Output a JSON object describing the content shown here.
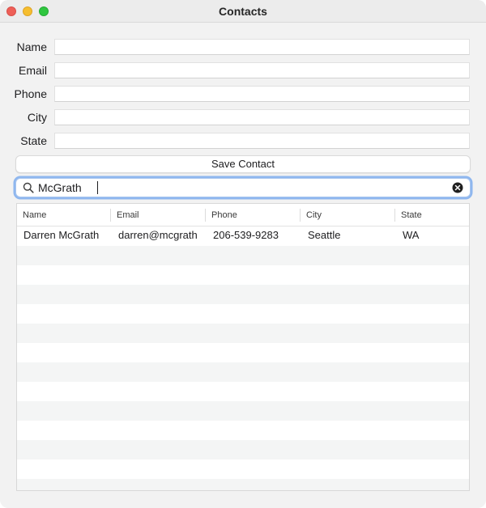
{
  "window": {
    "title": "Contacts"
  },
  "form": {
    "fields": [
      {
        "label": "Name",
        "value": ""
      },
      {
        "label": "Email",
        "value": ""
      },
      {
        "label": "Phone",
        "value": ""
      },
      {
        "label": "City",
        "value": ""
      },
      {
        "label": "State",
        "value": ""
      }
    ],
    "save_label": "Save Contact"
  },
  "search": {
    "value": "McGrath"
  },
  "table": {
    "columns": [
      "Name",
      "Email",
      "Phone",
      "City",
      "State"
    ],
    "rows": [
      [
        "Darren McGrath",
        "darren@mcgrath",
        "206-539-9283",
        "Seattle",
        "WA"
      ]
    ]
  },
  "icons": {
    "search": "magnifier-icon",
    "clear": "clear-x-circle-icon"
  },
  "colors": {
    "close": "#ee5f57",
    "minimize": "#f6be2f",
    "maximize": "#2fc63f",
    "focus_ring": "#8fb7ef",
    "row_stripe": "#f4f5f5"
  }
}
